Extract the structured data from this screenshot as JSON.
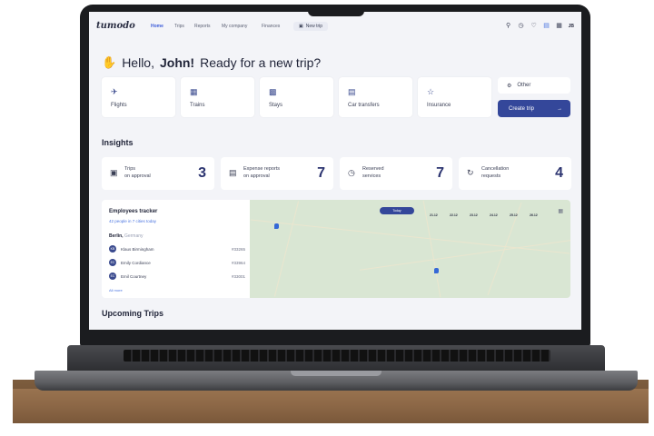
{
  "app": {
    "logo": "tumodo",
    "nav": [
      "Home",
      "Trips",
      "Reports",
      "My company",
      "Finances"
    ],
    "new_trip": "New trip",
    "icons": [
      "search-icon",
      "clock-icon",
      "heart-icon",
      "chat-icon",
      "grid-icon"
    ],
    "avatar_initials": "JB"
  },
  "greeting": {
    "hello": "Hello,",
    "name": "John!",
    "rest": "Ready for a new trip?"
  },
  "categories": [
    {
      "label": "Flights",
      "icon": "plane-icon"
    },
    {
      "label": "Trains",
      "icon": "train-icon"
    },
    {
      "label": "Stays",
      "icon": "building-icon"
    },
    {
      "label": "Car transfers",
      "icon": "car-icon"
    },
    {
      "label": "Insurance",
      "icon": "star-icon"
    }
  ],
  "other_label": "Other",
  "create_trip_label": "Create trip",
  "insights": {
    "title": "Insights",
    "cards": [
      {
        "line1": "Trips",
        "line2": "on approval",
        "value": "3"
      },
      {
        "line1": "Expense reports",
        "line2": "on approval",
        "value": "7"
      },
      {
        "line1": "Reserved",
        "line2": "services",
        "value": "7"
      },
      {
        "line1": "Cancellation",
        "line2": "requests",
        "value": "4"
      }
    ]
  },
  "tracker": {
    "title": "Employees tracker",
    "subtitle_count": "42 people in 7 cities",
    "subtitle_today": "today",
    "city": "Berlin,",
    "country": "Germany",
    "employees": [
      {
        "initials": "KB",
        "name": "Klaus Birmingham",
        "code": "#33265"
      },
      {
        "initials": "EC",
        "name": "Emily Cordiance",
        "code": "#33964"
      },
      {
        "initials": "EC",
        "name": "Emil Courtney",
        "code": "#33001"
      }
    ],
    "more": "All more",
    "today_pill": "Today",
    "dates": [
      "21.12",
      "22.12",
      "23.12",
      "24.12",
      "25.12",
      "26.12"
    ]
  },
  "upcoming_title": "Upcoming Trips"
}
